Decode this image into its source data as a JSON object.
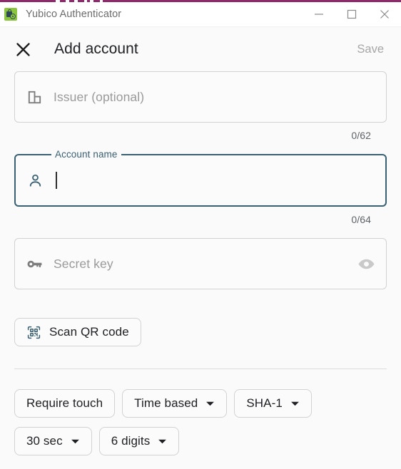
{
  "window": {
    "app_title": "Yubico Authenticator",
    "app_icon": "yubico-lock-icon",
    "accent_color": "#8e2a6b",
    "controls": {
      "minimize": "minimize-icon",
      "maximize": "maximize-icon",
      "close": "close-icon"
    }
  },
  "dialog": {
    "close_icon": "close-x-icon",
    "title": "Add account",
    "save_label": "Save",
    "save_enabled": false
  },
  "fields": {
    "issuer": {
      "icon": "building-icon",
      "placeholder": "Issuer (optional)",
      "value": "",
      "counter": "0/62",
      "focused": false
    },
    "account_name": {
      "icon": "person-icon",
      "label": "Account name",
      "value": "",
      "counter": "0/64",
      "focused": true,
      "focus_color": "#3a6074"
    },
    "secret_key": {
      "icon": "key-icon",
      "placeholder": "Secret key",
      "value": "",
      "reveal_icon": "eye-icon",
      "focused": false
    }
  },
  "scan_button": {
    "icon": "qr-code-icon",
    "label": "Scan QR code"
  },
  "options": {
    "row1": [
      {
        "label": "Require touch",
        "has_dropdown": false,
        "name": "require-touch"
      },
      {
        "label": "Time based",
        "has_dropdown": true,
        "name": "oath-type"
      },
      {
        "label": "SHA-1",
        "has_dropdown": true,
        "name": "hash-algorithm"
      }
    ],
    "row2": [
      {
        "label": "30 sec",
        "has_dropdown": true,
        "name": "period"
      },
      {
        "label": "6 digits",
        "has_dropdown": true,
        "name": "digits"
      }
    ]
  }
}
